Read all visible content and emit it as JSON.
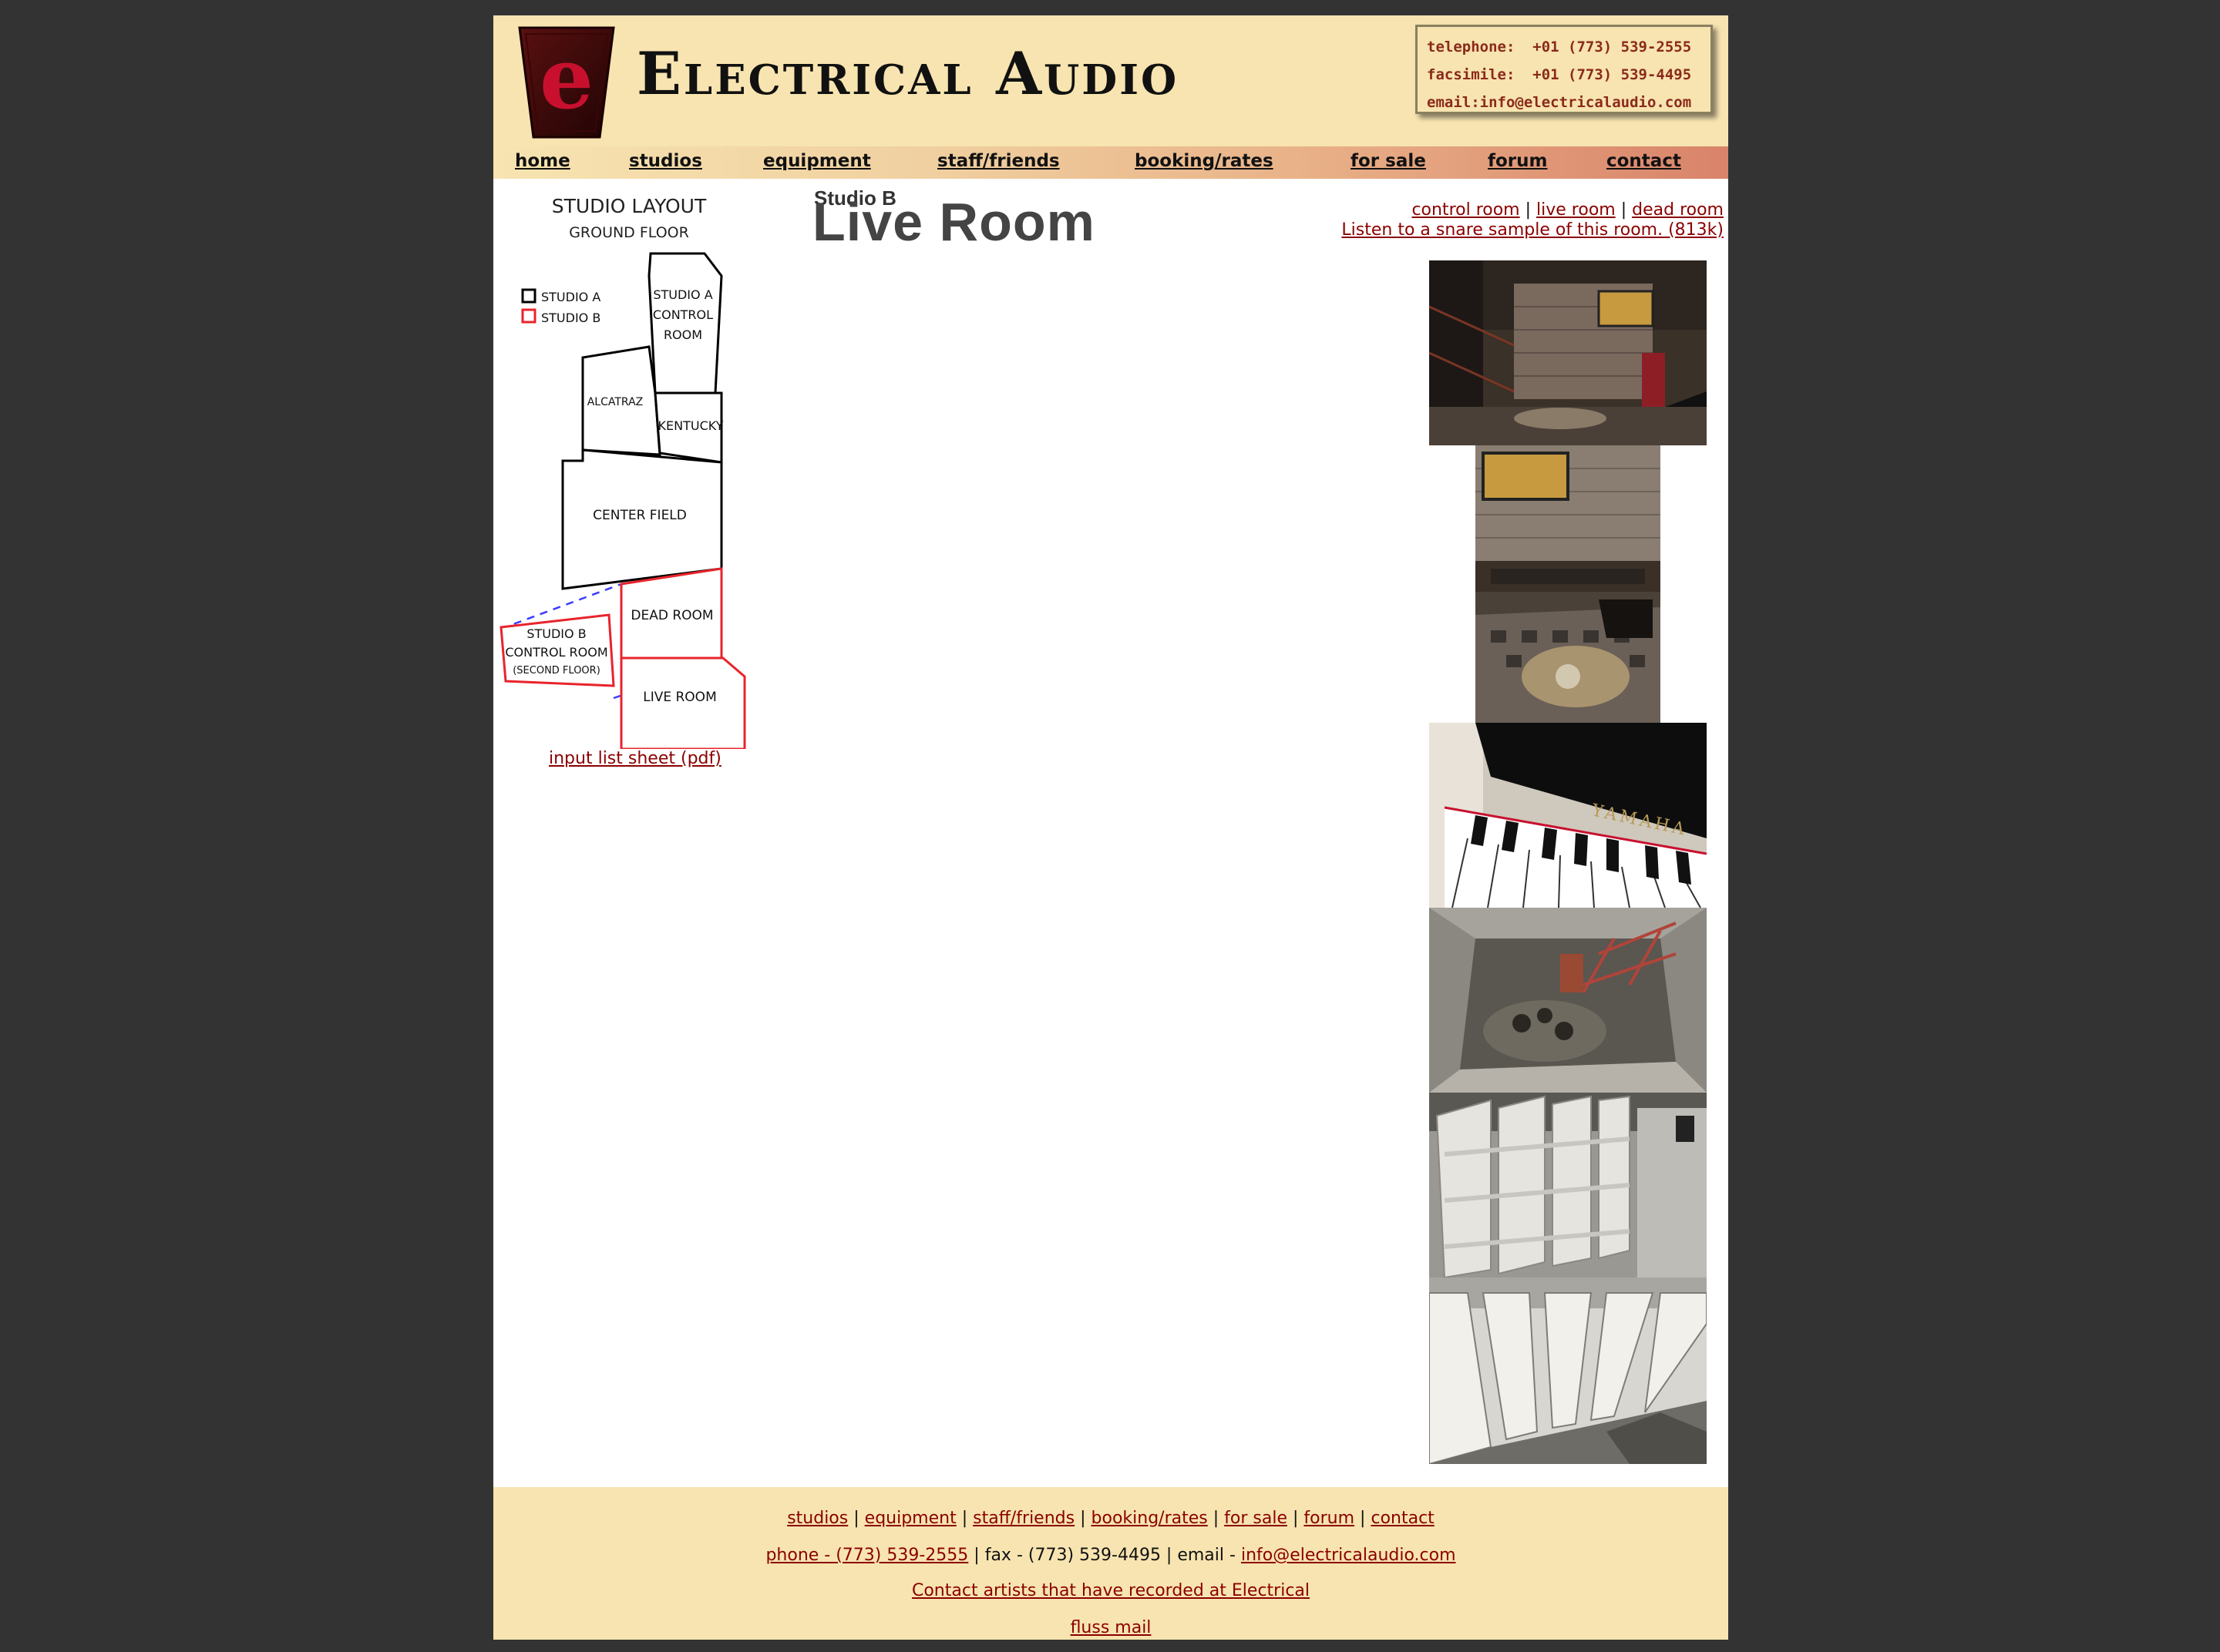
{
  "header": {
    "logo_letter": "e",
    "site_title": "Electrical Audio",
    "contact": {
      "telephone": "telephone:  +01 (773) 539-2555",
      "facsimile": "facsimile:  +01 (773) 539-4495",
      "email": "email:info@electricalaudio.com"
    }
  },
  "nav": {
    "items": [
      {
        "label": "home"
      },
      {
        "label": "studios"
      },
      {
        "label": "equipment"
      },
      {
        "label": "staff/friends"
      },
      {
        "label": "booking/rates"
      },
      {
        "label": "for sale"
      },
      {
        "label": "forum"
      },
      {
        "label": "contact"
      }
    ]
  },
  "layout_map": {
    "title": "STUDIO LAYOUT",
    "subtitle": "GROUND FLOOR",
    "legend_a": "STUDIO A",
    "legend_b": "STUDIO B",
    "rooms": {
      "studio_a_control_1": "STUDIO A",
      "studio_a_control_2": "CONTROL",
      "studio_a_control_3": "ROOM",
      "alcatraz": "ALCATRAZ",
      "kentucky": "KENTUCKY",
      "center_field": "CENTER FIELD",
      "dead_room": "DEAD ROOM",
      "studio_b_control_1": "STUDIO B",
      "studio_b_control_2": "CONTROL ROOM",
      "studio_b_control_3": "(SECOND FLOOR)",
      "live_room": "LIVE ROOM"
    },
    "colors": {
      "studio_a": "#000000",
      "studio_b": "#e8242c",
      "connector": "#3b3bff"
    }
  },
  "pdf_link": "input list sheet (pdf)",
  "page_title": {
    "small": "Studio B",
    "big": "Live Room"
  },
  "room_links": {
    "control_room": "control room",
    "live_room": "live room",
    "dead_room": "dead room",
    "separator": "|",
    "snare_sample": "Listen to a snare sample of this room. (813k)"
  },
  "footer": {
    "links": [
      "studios",
      "equipment",
      "staff/friends",
      "booking/rates",
      "for sale",
      "forum",
      "contact"
    ],
    "separator": "|",
    "phone_link": "phone - (773) 539-2555",
    "fax_text": "| fax - (773) 539-4495 | email -",
    "email_link": "info@electricalaudio.com",
    "artists_link": "Contact artists that have recorded at Electrical",
    "fluss_link": "fluss mail"
  },
  "colors": {
    "background": "#333333",
    "header_bg": "#f7e4b0",
    "link": "#8b0000",
    "logo_red": "#c8102e"
  }
}
